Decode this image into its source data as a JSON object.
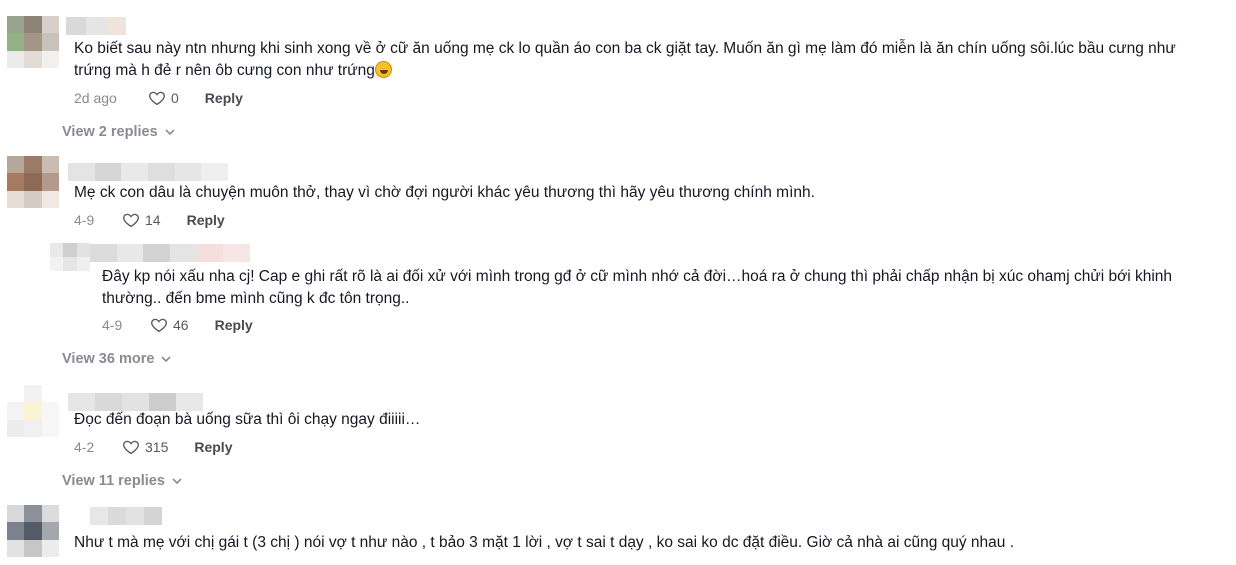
{
  "comments": [
    {
      "text_line1": "Ko biết sau này ntn nhưng khi sinh xong về ở cữ ăn uống mẹ ck lo quần áo con ba ck giặt tay. Muốn ăn gì mẹ làm đó miễn là ăn chín uống sôi.lúc bầu cưng như",
      "text_line2": "trứng mà h đẻ r nên ôb cưng con như trứng",
      "emoji": "rolling-laughing-emoji",
      "date": "2d ago",
      "likes": "0",
      "reply_label": "Reply",
      "view_replies": "View 2 replies",
      "avatar_colors": [
        "#9aa38d",
        "#8c8276",
        "#d6d0cc",
        "#93b387",
        "#a39686",
        "#c9c2bb",
        "#ecebeb",
        "#e2dbd6",
        "#f1f0ef"
      ],
      "username_colors": [
        "#d9d9d9",
        "#e5e5e5",
        "#f0e3db"
      ]
    },
    {
      "text_line1": "Mẹ ck con dâu là chuyện muôn thở, thay vì chờ đợi người khác yêu thương thì hãy yêu thương chính mình.",
      "date": "4-9",
      "likes": "14",
      "reply_label": "Reply",
      "avatar_colors": [
        "#b5a89a",
        "#9c7c66",
        "#c9bcb3",
        "#a57a5f",
        "#8d6a55",
        "#b39a8a",
        "#e4dcd5",
        "#d5cbc3",
        "#eee9e5"
      ],
      "username_colors": [
        "#e4e4e4",
        "#d5d5d5",
        "#e9e9e9",
        "#dedede",
        "#e6e6e6",
        "#efefef"
      ]
    },
    {
      "text_line1": "Đây kp nói xấu nha cj! Cap e ghi rất rõ là ai đối xử với mình trong gđ ở cữ mình nhớ cả đời…hoá ra ở chung thì phải chấp nhận bị xúc ohamj chửi bới khinh",
      "text_line2": "thường.. đến bme mình cũng k đc tôn trọng..",
      "date": "4-9",
      "likes": "46",
      "reply_label": "Reply",
      "view_replies": "View 36 more",
      "avatar_colors": [
        "#e9e9e9",
        "#cfcfcf",
        "#e2e2e2",
        "#f2f2f2",
        "#e6e6e6",
        "#efefef"
      ],
      "username_colors": [
        "#dcdcdc",
        "#e8e8e8",
        "#d3d3d3",
        "#e4e4e4",
        "#f5dede",
        "#f8e6e6"
      ]
    },
    {
      "text_line1": "Đọc đến đoạn bà uống sữa thì ôi chạy ngay điiiii…",
      "date": "4-2",
      "likes": "315",
      "reply_label": "Reply",
      "view_replies": "View 11 replies",
      "avatar_colors": [
        "#ffffff",
        "#f2f2f2",
        "#ffffff",
        "#f3f3f3",
        "#fbf4d2",
        "#f6f6f6",
        "#ececec",
        "#f0f0f0",
        "#f7f7f7"
      ],
      "username_colors": [
        "#e6e6e6",
        "#d9d9d9",
        "#e2e2e2",
        "#cccccc",
        "#e8e8e8"
      ]
    },
    {
      "text_line1": "Như t mà mẹ với chị gái t (3 chị ) nói vợ t như nào , t bảo 3 mặt 1 lời , vợ t sai t dạy , ko sai ko dc đặt điều. Giờ cả nhà ai cũng quý nhau .",
      "date": "",
      "likes": "",
      "reply_label": "",
      "avatar_colors": [
        "#d8d8d8",
        "#8b9099",
        "#dcdcdc",
        "#7c828d",
        "#545a66",
        "#a4a8ae",
        "#e2e2e2",
        "#c6c6c6",
        "#ececec"
      ],
      "username_colors": [
        "#e7e7e7",
        "#dadada",
        "#e2e2e2",
        "#d4d4d4"
      ]
    }
  ]
}
